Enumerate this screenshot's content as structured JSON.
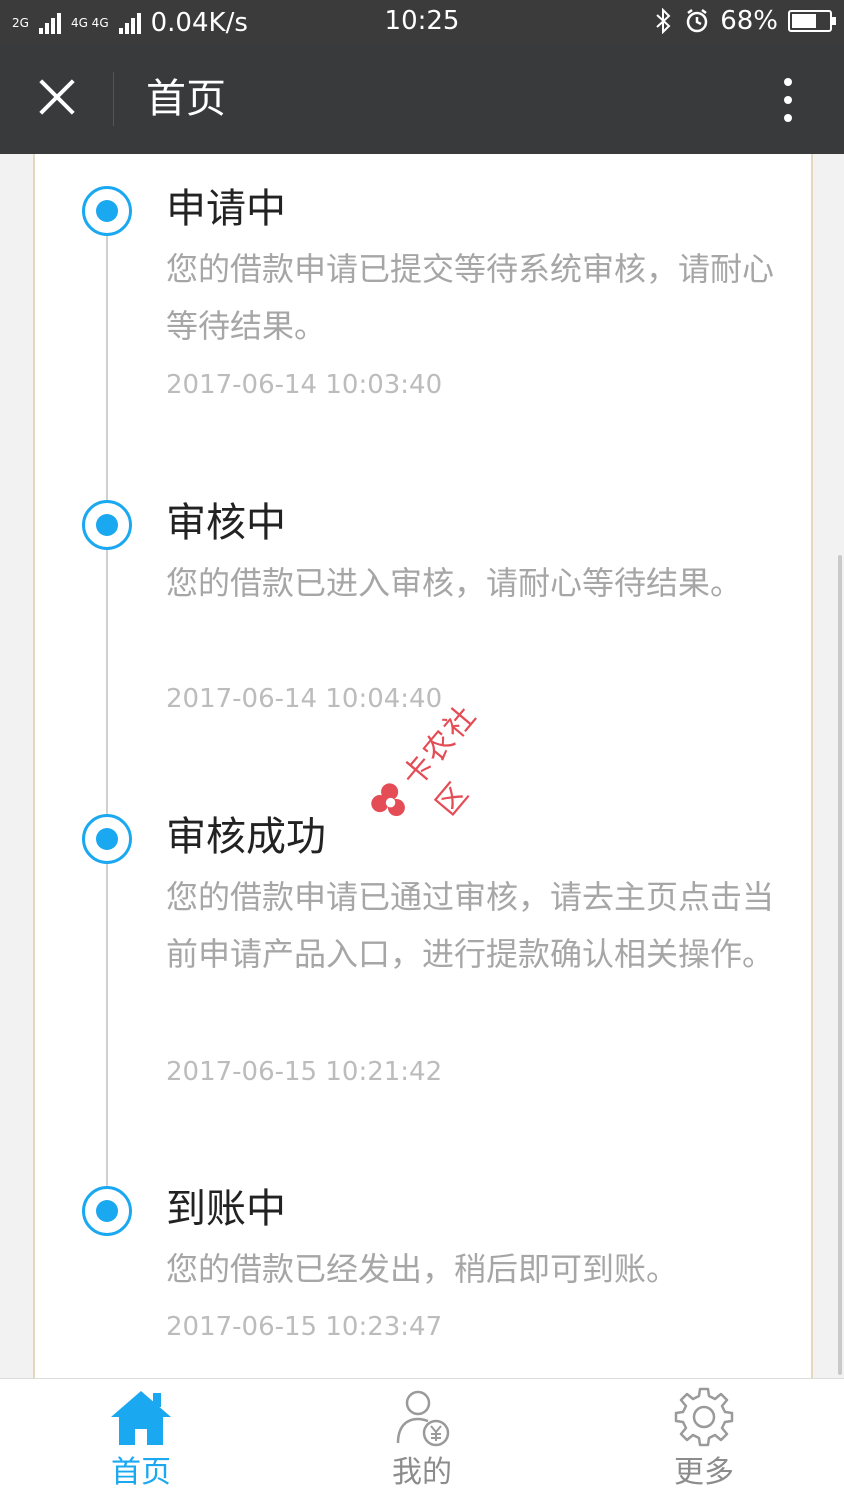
{
  "status_bar": {
    "network_left": "2G",
    "network_mid": "4G 4G",
    "speed": "0.04K/s",
    "time": "10:25",
    "battery": "68%",
    "battery_level": 0.68
  },
  "navbar": {
    "title": "首页"
  },
  "timeline": [
    {
      "title": "申请中",
      "desc": "您的借款申请已提交等待系统审核，请耐心等待结果。",
      "time": "2017-06-14 10:03:40"
    },
    {
      "title": "审核中",
      "desc": "您的借款已进入审核，请耐心等待结果。",
      "time": "2017-06-14 10:04:40"
    },
    {
      "title": "审核成功",
      "desc": "您的借款申请已通过审核，请去主页点击当前申请产品入口，进行提款确认相关操作。",
      "time": "2017-06-15 10:21:42"
    },
    {
      "title": "到账中",
      "desc": "您的借款已经发出，稍后即可到账。",
      "time": "2017-06-15 10:23:47"
    }
  ],
  "watermark": {
    "text": "卡农社区"
  },
  "tabbar": {
    "tabs": [
      {
        "label": "首页",
        "icon": "home-icon",
        "active": true
      },
      {
        "label": "我的",
        "icon": "user-yuan-icon",
        "active": false
      },
      {
        "label": "更多",
        "icon": "gear-icon",
        "active": false
      }
    ]
  },
  "colors": {
    "accent": "#1aa8f0",
    "navbar": "#393a3c",
    "muted_text": "#a6a6a6"
  }
}
